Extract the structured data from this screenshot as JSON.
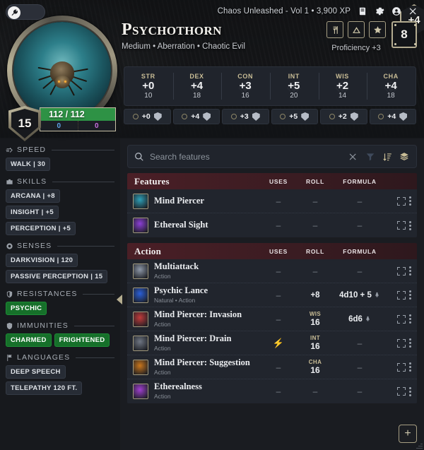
{
  "topbar": {
    "campaign": "Chaos Unleashed - Vol 1 • 3,900 XP",
    "edit_toggle_label": "",
    "icons": [
      "book-icon",
      "gear-icon",
      "account-icon",
      "close-icon"
    ]
  },
  "hero": {
    "name": "Psychothorn",
    "subtitle": "Medium • Aberration • Chaotic Evil",
    "initiative_bonus": "+4",
    "armor_class": "15",
    "hp_current_max": "112 / 112",
    "hp_temp": "0",
    "hp_extra": "0",
    "proficiency": "Proficiency +3",
    "challenge_rating": "8",
    "badges": [
      "utensils-icon",
      "triangle-icon",
      "star-icon"
    ]
  },
  "abilities": [
    {
      "name": "STR",
      "mod": "+0",
      "score": "10",
      "save": "+0"
    },
    {
      "name": "DEX",
      "mod": "+4",
      "score": "18",
      "save": "+4"
    },
    {
      "name": "CON",
      "mod": "+3",
      "score": "16",
      "save": "+3"
    },
    {
      "name": "INT",
      "mod": "+5",
      "score": "20",
      "save": "+5"
    },
    {
      "name": "WIS",
      "mod": "+2",
      "score": "14",
      "save": "+2"
    },
    {
      "name": "CHA",
      "mod": "+4",
      "score": "18",
      "save": "+4"
    }
  ],
  "sidebar": [
    {
      "icon": "speed-icon",
      "title": "SPEED",
      "tags": [
        {
          "label": "WALK | 30",
          "green": false
        }
      ]
    },
    {
      "icon": "skills-icon",
      "title": "SKILLS",
      "tags": [
        {
          "label": "ARCANA | +8",
          "green": false
        },
        {
          "label": "INSIGHT | +5",
          "green": false
        },
        {
          "label": "PERCEPTION | +5",
          "green": false
        }
      ]
    },
    {
      "icon": "senses-icon",
      "title": "SENSES",
      "tags": [
        {
          "label": "DARKVISION | 120",
          "green": false
        },
        {
          "label": "PASSIVE PERCEPTION | 15",
          "green": false
        }
      ]
    },
    {
      "icon": "resistance-icon",
      "title": "RESISTANCES",
      "tags": [
        {
          "label": "PSYCHIC",
          "green": true
        }
      ]
    },
    {
      "icon": "immunity-icon",
      "title": "IMMUNITIES",
      "tags": [
        {
          "label": "CHARMED",
          "green": true
        },
        {
          "label": "FRIGHTENED",
          "green": true
        }
      ]
    },
    {
      "icon": "language-icon",
      "title": "LANGUAGES",
      "tags": [
        {
          "label": "DEEP SPEECH",
          "green": false
        },
        {
          "label": "TELEPATHY 120 FT.",
          "green": false
        }
      ]
    }
  ],
  "search": {
    "placeholder": "Search features",
    "value": "",
    "icons": [
      "search-icon",
      "clear-icon",
      "filter-icon",
      "sort-icon",
      "layers-icon"
    ]
  },
  "columns": {
    "uses": "USES",
    "roll": "ROLL",
    "formula": "FORMULA"
  },
  "groups": [
    {
      "title": "Features",
      "rows": [
        {
          "name": "Mind Piercer",
          "sub": "",
          "uses": "–",
          "roll_ability": "",
          "roll": "–",
          "formula": "–",
          "formula_damage": false,
          "thumb": "#2ea0b8"
        },
        {
          "name": "Ethereal Sight",
          "sub": "",
          "uses": "–",
          "roll_ability": "",
          "roll": "–",
          "formula": "–",
          "formula_damage": false,
          "thumb": "#8c3fd6"
        }
      ]
    },
    {
      "title": "Action",
      "rows": [
        {
          "name": "Multiattack",
          "sub": "Action",
          "uses": "–",
          "roll_ability": "",
          "roll": "–",
          "formula": "–",
          "formula_damage": false,
          "thumb": "#8e98a8"
        },
        {
          "name": "Psychic Lance",
          "sub": "Natural • Action",
          "uses": "–",
          "roll_ability": "",
          "roll": "+8",
          "formula": "4d10 + 5",
          "formula_damage": true,
          "thumb": "#2b5fd8"
        },
        {
          "name": "Mind Piercer: Invasion",
          "sub": "Action",
          "uses": "–",
          "roll_ability": "WIS",
          "roll": "16",
          "formula": "6d6",
          "formula_damage": true,
          "thumb": "#c13b3b"
        },
        {
          "name": "Mind Piercer: Drain",
          "sub": "Action",
          "uses": "bolt",
          "roll_ability": "INT",
          "roll": "16",
          "formula": "–",
          "formula_damage": false,
          "thumb": "#6f7683"
        },
        {
          "name": "Mind Piercer: Suggestion",
          "sub": "Action",
          "uses": "–",
          "roll_ability": "CHA",
          "roll": "16",
          "formula": "–",
          "formula_damage": false,
          "thumb": "#c9761c"
        },
        {
          "name": "Etherealness",
          "sub": "Action",
          "uses": "–",
          "roll_ability": "",
          "roll": "–",
          "formula": "–",
          "formula_damage": false,
          "thumb": "#a03fd0"
        }
      ]
    }
  ],
  "add_button_label": "+",
  "colors": {
    "group_header": "#4a1f26",
    "hp_bar": "#2e9245",
    "accent_gold": "#c9bd96",
    "tag_green": "#16702a",
    "panel": "#20242c"
  }
}
